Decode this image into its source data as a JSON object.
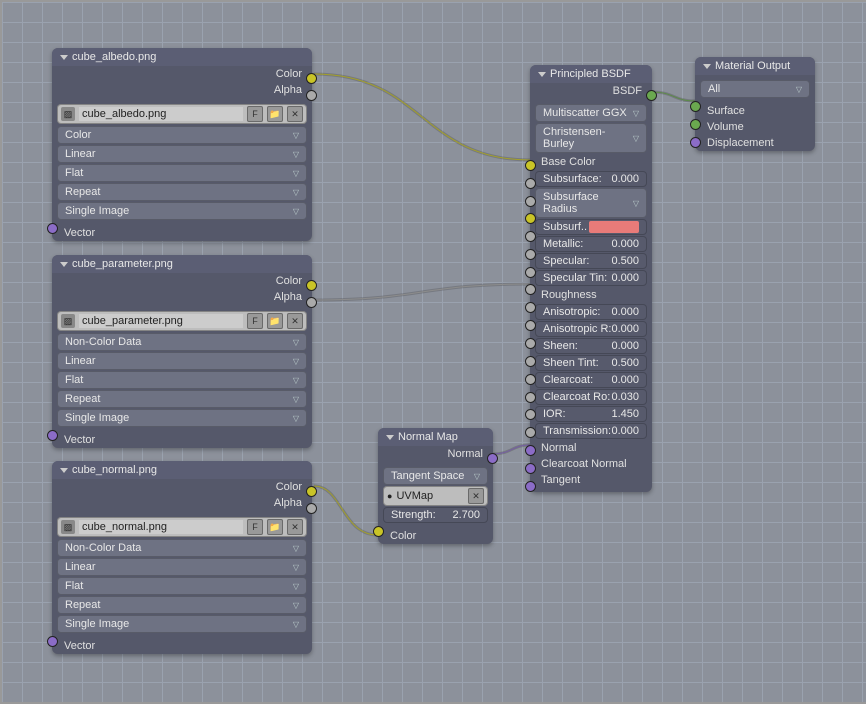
{
  "nodes": {
    "albedo": {
      "title": "cube_albedo.png",
      "outputs": {
        "color": "Color",
        "alpha": "Alpha"
      },
      "image_name": "cube_albedo.png",
      "dropdowns": [
        "Color",
        "Linear",
        "Flat",
        "Repeat",
        "Single Image"
      ],
      "input": "Vector"
    },
    "parameter": {
      "title": "cube_parameter.png",
      "outputs": {
        "color": "Color",
        "alpha": "Alpha"
      },
      "image_name": "cube_parameter.png",
      "dropdowns": [
        "Non-Color Data",
        "Linear",
        "Flat",
        "Repeat",
        "Single Image"
      ],
      "input": "Vector"
    },
    "normal": {
      "title": "cube_normal.png",
      "outputs": {
        "color": "Color",
        "alpha": "Alpha"
      },
      "image_name": "cube_normal.png",
      "dropdowns": [
        "Non-Color Data",
        "Linear",
        "Flat",
        "Repeat",
        "Single Image"
      ],
      "input": "Vector"
    },
    "normalmap": {
      "title": "Normal Map",
      "output": "Normal",
      "space": "Tangent Space",
      "uvmap": "UVMap",
      "strength_label": "Strength:",
      "strength_value": "2.700",
      "input": "Color"
    },
    "principled": {
      "title": "Principled BSDF",
      "output": "BSDF",
      "dist": "Multiscatter GGX",
      "sss": "Christensen-Burley",
      "sockets": [
        {
          "label": "Base Color",
          "type": "socket"
        },
        {
          "label": "Subsurface:",
          "value": "0.000",
          "type": "num"
        },
        {
          "label": "Subsurface Radius",
          "type": "dd"
        },
        {
          "label": "Subsurf..",
          "type": "swatch"
        },
        {
          "label": "Metallic:",
          "value": "0.000",
          "type": "num"
        },
        {
          "label": "Specular:",
          "value": "0.500",
          "type": "num"
        },
        {
          "label": "Specular Tin:",
          "value": "0.000",
          "type": "num"
        },
        {
          "label": "Roughness",
          "type": "socket"
        },
        {
          "label": "Anisotropic:",
          "value": "0.000",
          "type": "num"
        },
        {
          "label": "Anisotropic R:",
          "value": "0.000",
          "type": "num"
        },
        {
          "label": "Sheen:",
          "value": "0.000",
          "type": "num"
        },
        {
          "label": "Sheen Tint:",
          "value": "0.500",
          "type": "num"
        },
        {
          "label": "Clearcoat:",
          "value": "0.000",
          "type": "num"
        },
        {
          "label": "Clearcoat Ro:",
          "value": "0.030",
          "type": "num"
        },
        {
          "label": "IOR:",
          "value": "1.450",
          "type": "num"
        },
        {
          "label": "Transmission:",
          "value": "0.000",
          "type": "num"
        },
        {
          "label": "Normal",
          "type": "socket"
        },
        {
          "label": "Clearcoat Normal",
          "type": "socket"
        },
        {
          "label": "Tangent",
          "type": "socket"
        }
      ]
    },
    "output": {
      "title": "Material Output",
      "target": "All",
      "inputs": [
        "Surface",
        "Volume",
        "Displacement"
      ]
    }
  }
}
